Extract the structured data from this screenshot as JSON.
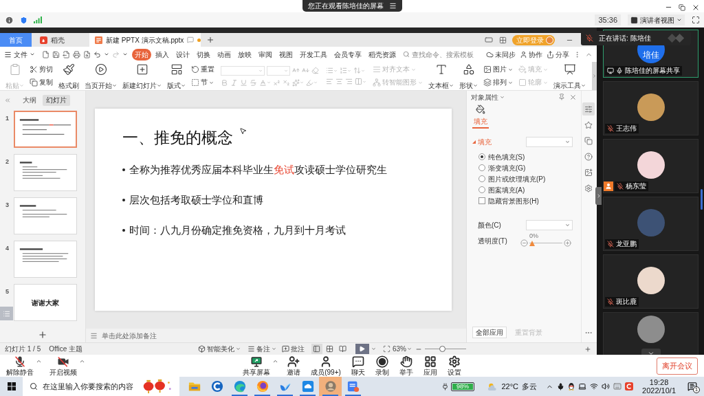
{
  "meeting_top": {
    "sharing_notice": "您正在观看陈培佳的屏幕",
    "timer": "35:36",
    "view_mode": "演讲者视图"
  },
  "wps_tabs": [
    {
      "kind": "home",
      "label": "首页",
      "selected": false
    },
    {
      "kind": "docer",
      "label": "稻壳",
      "selected": false
    },
    {
      "kind": "document",
      "label": "新建 PPTX 演示文稿.pptx",
      "selected": true,
      "unsaved": true
    }
  ],
  "login_button": "立即登录",
  "menu_bar": {
    "file": "文件",
    "tabs": [
      {
        "label": "开始",
        "selected": true
      },
      {
        "label": "插入",
        "selected": false
      },
      {
        "label": "设计",
        "selected": false
      },
      {
        "label": "切换",
        "selected": false
      },
      {
        "label": "动画",
        "selected": false
      },
      {
        "label": "放映",
        "selected": false
      },
      {
        "label": "审阅",
        "selected": false
      },
      {
        "label": "视图",
        "selected": false
      },
      {
        "label": "开发工具",
        "selected": false
      },
      {
        "label": "会员专享",
        "selected": false
      },
      {
        "label": "稻壳资源",
        "selected": false
      }
    ],
    "search": {
      "placeholder": "查找命令、搜索模板"
    },
    "actions": [
      "未同步",
      "协作",
      "分享"
    ]
  },
  "ribbon": [
    {
      "kind": "large",
      "label": "粘贴",
      "dropdown": true,
      "disabled": true
    },
    {
      "kind": "pair",
      "items": [
        {
          "label": "剪切",
          "dropdown": false,
          "disabled": false
        },
        {
          "label": "复制",
          "dropdown": false,
          "disabled": false
        }
      ]
    },
    {
      "kind": "large",
      "label": "格式刷",
      "dropdown": false,
      "disabled": false
    },
    {
      "kind": "large",
      "label": "当页开始",
      "dropdown": true,
      "disabled": false
    },
    {
      "kind": "large",
      "label": "新建幻灯片",
      "dropdown": true,
      "disabled": false
    },
    {
      "kind": "large",
      "label": "版式",
      "dropdown": true,
      "disabled": false
    },
    {
      "kind": "pair",
      "items": [
        {
          "label": "重置",
          "dropdown": false,
          "disabled": false
        },
        {
          "label": "节",
          "dropdown": true,
          "disabled": false
        }
      ]
    },
    {
      "kind": "font",
      "disabled": true
    },
    {
      "kind": "paragraph",
      "disabled": true
    },
    {
      "kind": "pair",
      "items": [
        {
          "label": "对齐文本",
          "dropdown": true,
          "disabled": true
        },
        {
          "label": "转智能图形",
          "dropdown": true,
          "disabled": true
        }
      ]
    },
    {
      "kind": "large",
      "label": "文本框",
      "dropdown": true,
      "disabled": false
    },
    {
      "kind": "large",
      "label": "形状",
      "dropdown": true,
      "disabled": false
    },
    {
      "kind": "pair",
      "items": [
        {
          "label": "图片",
          "dropdown": true,
          "disabled": false
        },
        {
          "label": "排列",
          "dropdown": true,
          "disabled": false
        }
      ]
    },
    {
      "kind": "pair",
      "items": [
        {
          "label": "填充",
          "dropdown": true,
          "disabled": true
        },
        {
          "label": "轮廓",
          "dropdown": true,
          "disabled": true
        }
      ]
    },
    {
      "kind": "large",
      "label": "演示工具",
      "dropdown": true,
      "disabled": false
    }
  ],
  "outline_tabs": [
    {
      "label": "大纲",
      "selected": false
    },
    {
      "label": "幻灯片",
      "selected": true
    }
  ],
  "slides": [
    {
      "number": "1",
      "kind": "content",
      "selected": true
    },
    {
      "number": "2",
      "kind": "content",
      "selected": false
    },
    {
      "number": "3",
      "kind": "content",
      "selected": false
    },
    {
      "number": "4",
      "kind": "content",
      "selected": false
    },
    {
      "number": "5",
      "kind": "title",
      "text": "谢谢大家",
      "selected": false
    }
  ],
  "slide": {
    "title": "一、推免的概念",
    "bullets": [
      {
        "segments": [
          {
            "text": "全称为推荐优秀应届本科毕业生",
            "highlight": false
          },
          {
            "text": "免试",
            "highlight": true
          },
          {
            "text": "攻读硕士学位研究生",
            "highlight": false
          }
        ]
      },
      {
        "segments": [
          {
            "text": "层次包括考取硕士学位和直博",
            "highlight": false
          }
        ]
      },
      {
        "segments": [
          {
            "text": "时间：八九月份确定推免资格，九月到十月考试",
            "highlight": false
          }
        ]
      }
    ]
  },
  "notes": {
    "placeholder": "单击此处添加备注"
  },
  "property_panel": {
    "title": "对象属性",
    "tabs": [
      {
        "label": "填充",
        "selected": true
      }
    ],
    "section": {
      "label": "填充",
      "expanded": true
    },
    "fill_options": [
      {
        "label": "纯色填充(S)",
        "selected": true
      },
      {
        "label": "渐变填充(G)",
        "selected": false
      },
      {
        "label": "图片或纹理填充(P)",
        "selected": false
      },
      {
        "label": "图案填充(A)",
        "selected": false
      }
    ],
    "hide_background": {
      "label": "隐藏背景图形(H)",
      "checked": false
    },
    "color_label": "颜色(C)",
    "transparency": {
      "label": "透明度(T)",
      "reading": "0%",
      "level": 0
    },
    "buttons": [
      {
        "label": "全部应用",
        "disabled": false
      },
      {
        "label": "重置背景",
        "disabled": true
      }
    ]
  },
  "side_tools": [
    {
      "selected": true
    },
    {
      "selected": false
    },
    {
      "selected": false
    },
    {
      "selected": false
    },
    {
      "selected": false
    },
    {
      "selected": false
    }
  ],
  "status_bar": {
    "slide_count": "幻灯片 1 / 5",
    "theme": "Office 主题",
    "beautify": "智能美化",
    "notes": "备注",
    "comments": "批注",
    "views": [
      {
        "selected": true
      },
      {
        "selected": false
      },
      {
        "selected": false
      }
    ],
    "zoom": "63%",
    "zoom_slider": {
      "level": 0.42
    }
  },
  "participants": {
    "speaking_banner": "正在讲话: 陈培佳",
    "tiles": [
      {
        "kind": "initials",
        "avatar_text": "培佳",
        "name": "陈培佳的屏幕共享",
        "sharing": true,
        "host": false,
        "muted": false,
        "active": true
      },
      {
        "kind": "photo",
        "name": "王志伟",
        "sharing": false,
        "host": false,
        "muted": true,
        "active": false
      },
      {
        "kind": "photo",
        "name": "杨东莹",
        "sharing": false,
        "host": true,
        "muted": true,
        "active": false
      },
      {
        "kind": "photo",
        "name": "龙亚鹏",
        "sharing": false,
        "host": false,
        "muted": true,
        "active": false
      },
      {
        "kind": "photo",
        "name": "斑比鹿",
        "sharing": false,
        "host": false,
        "muted": true,
        "active": false
      },
      {
        "kind": "photo",
        "active": false
      }
    ]
  },
  "meeting_toolbar": {
    "left": [
      {
        "label": "解除静音",
        "menu": true
      },
      {
        "label": "开启视频",
        "menu": true
      }
    ],
    "center": [
      {
        "label": "共享屏幕",
        "menu": true
      },
      {
        "label": "邀请",
        "menu": false
      },
      {
        "label": "成员(99+)",
        "menu": false
      },
      {
        "label": "聊天",
        "menu": false
      },
      {
        "label": "录制",
        "menu": false
      },
      {
        "label": "举手",
        "menu": false
      },
      {
        "label": "应用",
        "menu": false
      },
      {
        "label": "设置",
        "menu": false
      }
    ],
    "leave": "离开会议"
  },
  "taskbar": {
    "search": {
      "placeholder": "在这里输入你要搜索的内容"
    },
    "apps": [
      {
        "running": false,
        "active": false
      },
      {
        "running": false,
        "active": false
      },
      {
        "running": true,
        "active": false
      },
      {
        "running": true,
        "active": false
      },
      {
        "running": true,
        "active": false
      },
      {
        "running": true,
        "active": false
      },
      {
        "running": true,
        "active": true
      },
      {
        "running": true,
        "active": false
      }
    ],
    "battery": "98%",
    "temperature": "22°C",
    "weather": "多云",
    "time": "19:28",
    "date": "2022/10/1",
    "notifications": "1"
  }
}
